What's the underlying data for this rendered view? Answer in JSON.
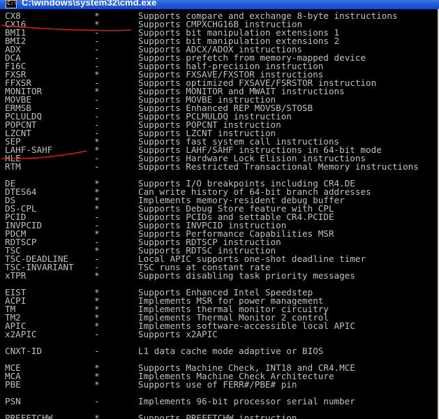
{
  "window": {
    "title": "C:\\windows\\system32\\cmd.exe",
    "icon": "cmd-console-icon"
  },
  "rows": [
    {
      "flag": "CX8",
      "mark": "*",
      "desc": "Supports compare and exchange 8-byte instructions"
    },
    {
      "flag": "CX16",
      "mark": "*",
      "desc": "Supports CMPXCHG16B instruction"
    },
    {
      "flag": "BMI1",
      "mark": "-",
      "desc": "Supports bit manipulation extensions 1"
    },
    {
      "flag": "BMI2",
      "mark": "-",
      "desc": "Supports bit manipulation extensions 2"
    },
    {
      "flag": "ADX",
      "mark": "-",
      "desc": "Supports ADCX/ADOX instructions"
    },
    {
      "flag": "DCA",
      "mark": "-",
      "desc": "Supports prefetch from memory-mapped device"
    },
    {
      "flag": "F16C",
      "mark": "-",
      "desc": "Supports half-precision instruction"
    },
    {
      "flag": "FXSR",
      "mark": "*",
      "desc": "Supports FXSAVE/FXSTOR instructions"
    },
    {
      "flag": "FFXSR",
      "mark": "-",
      "desc": "Supports optimized FXSAVE/FSRSTOR instruction"
    },
    {
      "flag": "MONITOR",
      "mark": "*",
      "desc": "Supports MONITOR and MWAIT instructions"
    },
    {
      "flag": "MOVBE",
      "mark": "-",
      "desc": "Supports MOVBE instruction"
    },
    {
      "flag": "ERMSB",
      "mark": "-",
      "desc": "Supports Enhanced REP MOVSB/STOSB"
    },
    {
      "flag": "PCLULDQ",
      "mark": "-",
      "desc": "Supports PCLMULDQ instruction"
    },
    {
      "flag": "POPCNT",
      "mark": "-",
      "desc": "Supports POPCNT instruction"
    },
    {
      "flag": "LZCNT",
      "mark": "-",
      "desc": "Supports LZCNT instruction"
    },
    {
      "flag": "SEP",
      "mark": "*",
      "desc": "Supports fast system call instructions"
    },
    {
      "flag": "LAHF-SAHF",
      "mark": "*",
      "desc": "Supports LAHF/SAHF instructions in 64-bit mode"
    },
    {
      "flag": "HLE",
      "mark": "-",
      "desc": "Supports Hardware Lock Elision instructions"
    },
    {
      "flag": "RTM",
      "mark": "-",
      "desc": "Supports Restricted Transactional Memory instructions"
    },
    {
      "flag": "",
      "mark": "",
      "desc": ""
    },
    {
      "flag": "DE",
      "mark": "*",
      "desc": "Supports I/O breakpoints including CR4.DE"
    },
    {
      "flag": "DTES64",
      "mark": "*",
      "desc": "Can write history of 64-bit branch addresses"
    },
    {
      "flag": "DS",
      "mark": "*",
      "desc": "Implements memory-resident debug buffer"
    },
    {
      "flag": "DS-CPL",
      "mark": "*",
      "desc": "Supports Debug Store feature with CPL"
    },
    {
      "flag": "PCID",
      "mark": "-",
      "desc": "Supports PCIDs and settable CR4.PCIDE"
    },
    {
      "flag": "INVPCID",
      "mark": "-",
      "desc": "Supports INVPCID instruction"
    },
    {
      "flag": "PDCM",
      "mark": "*",
      "desc": "Supports Performance Capabilities MSR"
    },
    {
      "flag": "RDTSCP",
      "mark": "-",
      "desc": "Supports RDTSCP instruction"
    },
    {
      "flag": "TSC",
      "mark": "*",
      "desc": "Supports RDTSC instruction"
    },
    {
      "flag": "TSC-DEADLINE",
      "mark": "-",
      "desc": "Local APIC supports one-shot deadline timer"
    },
    {
      "flag": "TSC-INVARIANT",
      "mark": "-",
      "desc": "TSC runs at constant rate"
    },
    {
      "flag": "xTPR",
      "mark": "*",
      "desc": "Supports disabling task priority messages"
    },
    {
      "flag": "",
      "mark": "",
      "desc": ""
    },
    {
      "flag": "EIST",
      "mark": "*",
      "desc": "Supports Enhanced Intel Speedstep"
    },
    {
      "flag": "ACPI",
      "mark": "*",
      "desc": "Implements MSR for power management"
    },
    {
      "flag": "TM",
      "mark": "*",
      "desc": "Implements thermal monitor circuitry"
    },
    {
      "flag": "TM2",
      "mark": "*",
      "desc": "Implements Thermal Monitor 2 control"
    },
    {
      "flag": "APIC",
      "mark": "*",
      "desc": "Implements software-accessible local APIC"
    },
    {
      "flag": "x2APIC",
      "mark": "-",
      "desc": "Supports x2APIC"
    },
    {
      "flag": "",
      "mark": "",
      "desc": ""
    },
    {
      "flag": "CNXT-ID",
      "mark": "-",
      "desc": "L1 data cache mode adaptive or BIOS"
    },
    {
      "flag": "",
      "mark": "",
      "desc": ""
    },
    {
      "flag": "MCE",
      "mark": "*",
      "desc": "Supports Machine Check, INT18 and CR4.MCE"
    },
    {
      "flag": "MCA",
      "mark": "*",
      "desc": "Implements Machine Check Architecture"
    },
    {
      "flag": "PBE",
      "mark": "*",
      "desc": "Supports use of FERR#/PBE# pin"
    },
    {
      "flag": "",
      "mark": "",
      "desc": ""
    },
    {
      "flag": "PSN",
      "mark": "-",
      "desc": "Implements 96-bit processor serial number"
    },
    {
      "flag": "",
      "mark": "",
      "desc": ""
    },
    {
      "flag": "PREFETCHW",
      "mark": "*",
      "desc": "Supports PREFETCHW instruction"
    }
  ],
  "colors": {
    "console_bg": "#000000",
    "console_text": "#c0c0c0",
    "annotation": "#e01818",
    "titlebar": "#1e55d2"
  },
  "annotations": [
    {
      "kind": "red-underline",
      "target_row": "CX16"
    },
    {
      "kind": "red-underline",
      "target_row": "LAHF-SAHF"
    }
  ]
}
